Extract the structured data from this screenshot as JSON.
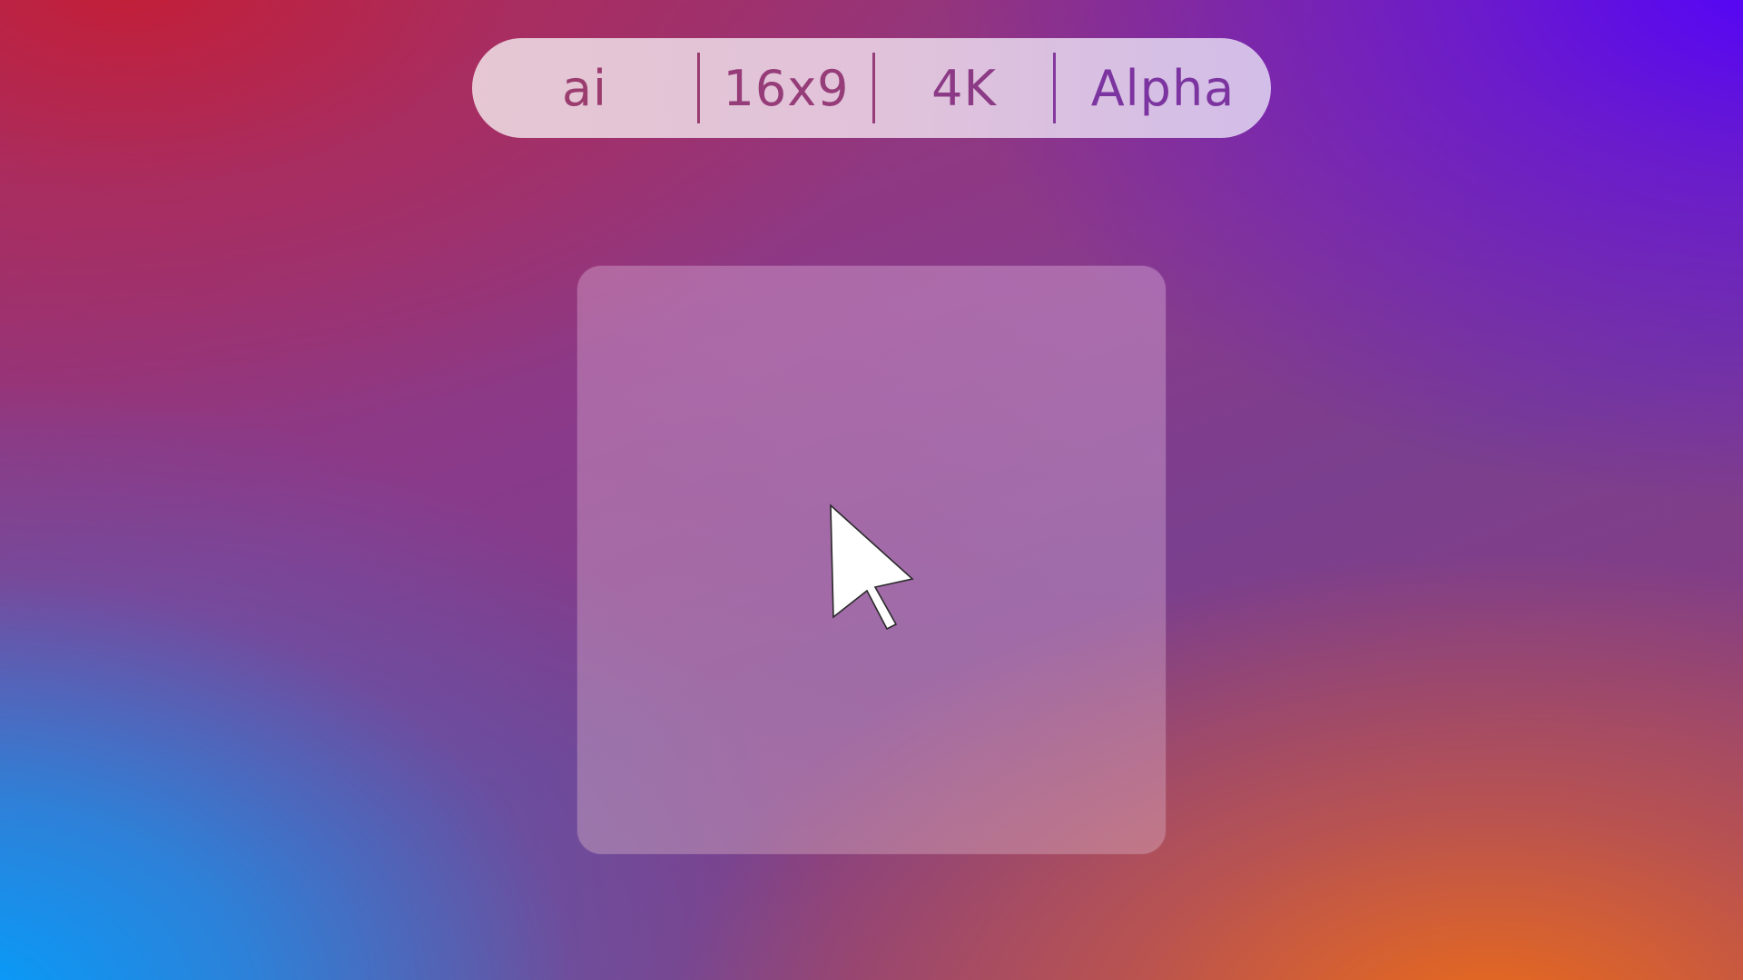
{
  "toolbar": {
    "items": [
      {
        "label": "ai"
      },
      {
        "label": "16x9"
      },
      {
        "label": "4K"
      },
      {
        "label": "Alpha"
      }
    ]
  },
  "canvas": {
    "cursor_icon": "arrow-pointer-icon"
  }
}
